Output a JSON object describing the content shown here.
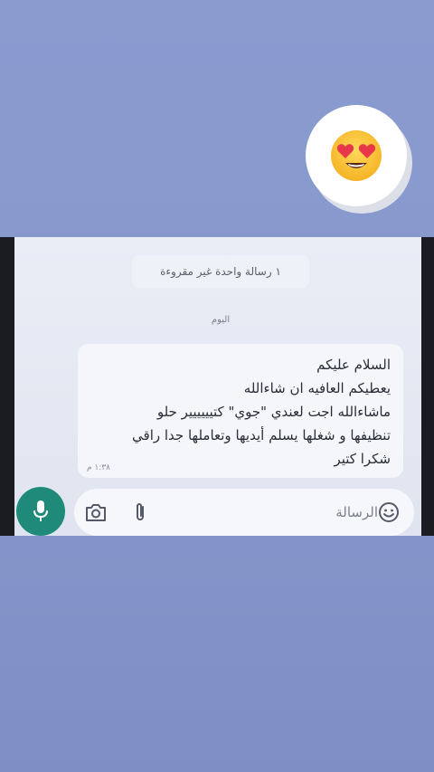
{
  "chat": {
    "unread_banner": "١ رسالة واحدة غير مقروءة",
    "date_chip": "اليوم",
    "message": {
      "lines": [
        "السلام عليكم",
        "يعطيكم العافيه ان شاءالله",
        "ماشاءالله اجت لعندي \"جوي\" كتيييييير حلو",
        "تنظيفها و شغلها يسلم أيديها وتعاملها جدا راقي",
        "شكرا كتير"
      ],
      "time": "١:٣٨ م"
    },
    "input": {
      "placeholder": "الرسالة"
    }
  },
  "icons": {
    "sticker": "heart-eyes-emoji",
    "mic": "microphone-icon",
    "camera": "camera-icon",
    "attach": "paperclip-icon",
    "emoji": "smiley-icon"
  },
  "colors": {
    "background": "#8a9bd0",
    "mic_button": "#1f8a7a",
    "bubble": "#f4f6fa"
  }
}
